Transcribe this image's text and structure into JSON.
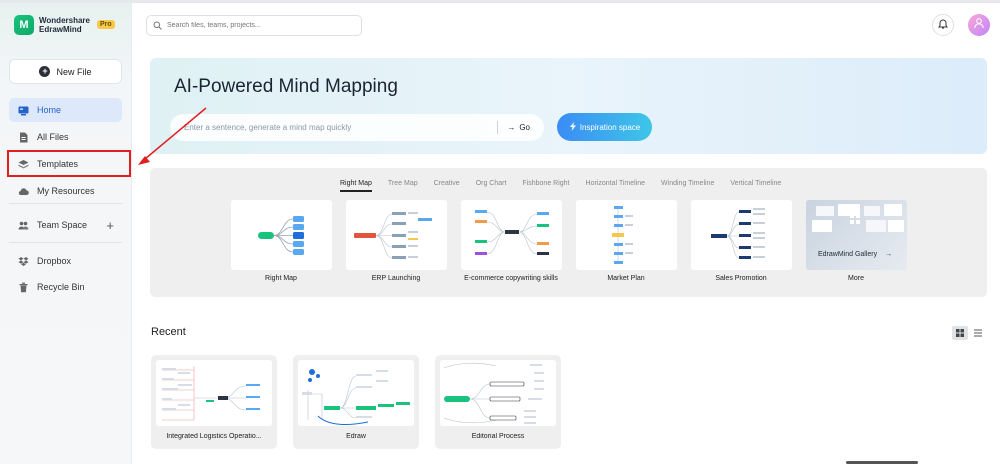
{
  "app": {
    "brand_line1": "Wondershare",
    "brand_line2": "EdrawMind",
    "badge": "Pro",
    "brand_color": "#19c37d"
  },
  "sidebar": {
    "new_file": "New File",
    "items": [
      {
        "label": "Home",
        "icon": "home-icon",
        "active": true
      },
      {
        "label": "All Files",
        "icon": "files-icon"
      },
      {
        "label": "Templates",
        "icon": "templates-icon"
      },
      {
        "label": "My Resources",
        "icon": "cloud-icon"
      },
      {
        "label": "Team Space",
        "icon": "team-icon"
      },
      {
        "label": "Dropbox",
        "icon": "dropbox-icon"
      },
      {
        "label": "Recycle Bin",
        "icon": "trash-icon"
      }
    ],
    "team_add": "+"
  },
  "header": {
    "search_placeholder": "Search files, teams, projects..."
  },
  "hero": {
    "title": "AI-Powered Mind Mapping",
    "input_placeholder": "Enter a sentence, generate a mind map quickly",
    "go_label": "Go",
    "inspiration_label": "Inspiration space"
  },
  "templates": {
    "tabs": [
      "Right Map",
      "Tree Map",
      "Creative",
      "Org Chart",
      "Fishbone Right",
      "Horizontal Timeline",
      "Winding Timeline",
      "Vertical Timeline"
    ],
    "active_tab": "Right Map",
    "cards": [
      "Right Map",
      "ERP Launching",
      "E-commerce copywriting skills",
      "Market Plan",
      "Sales Promotion",
      "More"
    ],
    "gallery_label": "EdrawMind Gallery",
    "gallery_arrow": "→"
  },
  "recent": {
    "title": "Recent",
    "files": [
      "Integrated Logistics Operatio...",
      "Edraw",
      "Editorial Process"
    ]
  },
  "colors": {
    "accent": "#2563c9",
    "annotation": "#e02020"
  }
}
